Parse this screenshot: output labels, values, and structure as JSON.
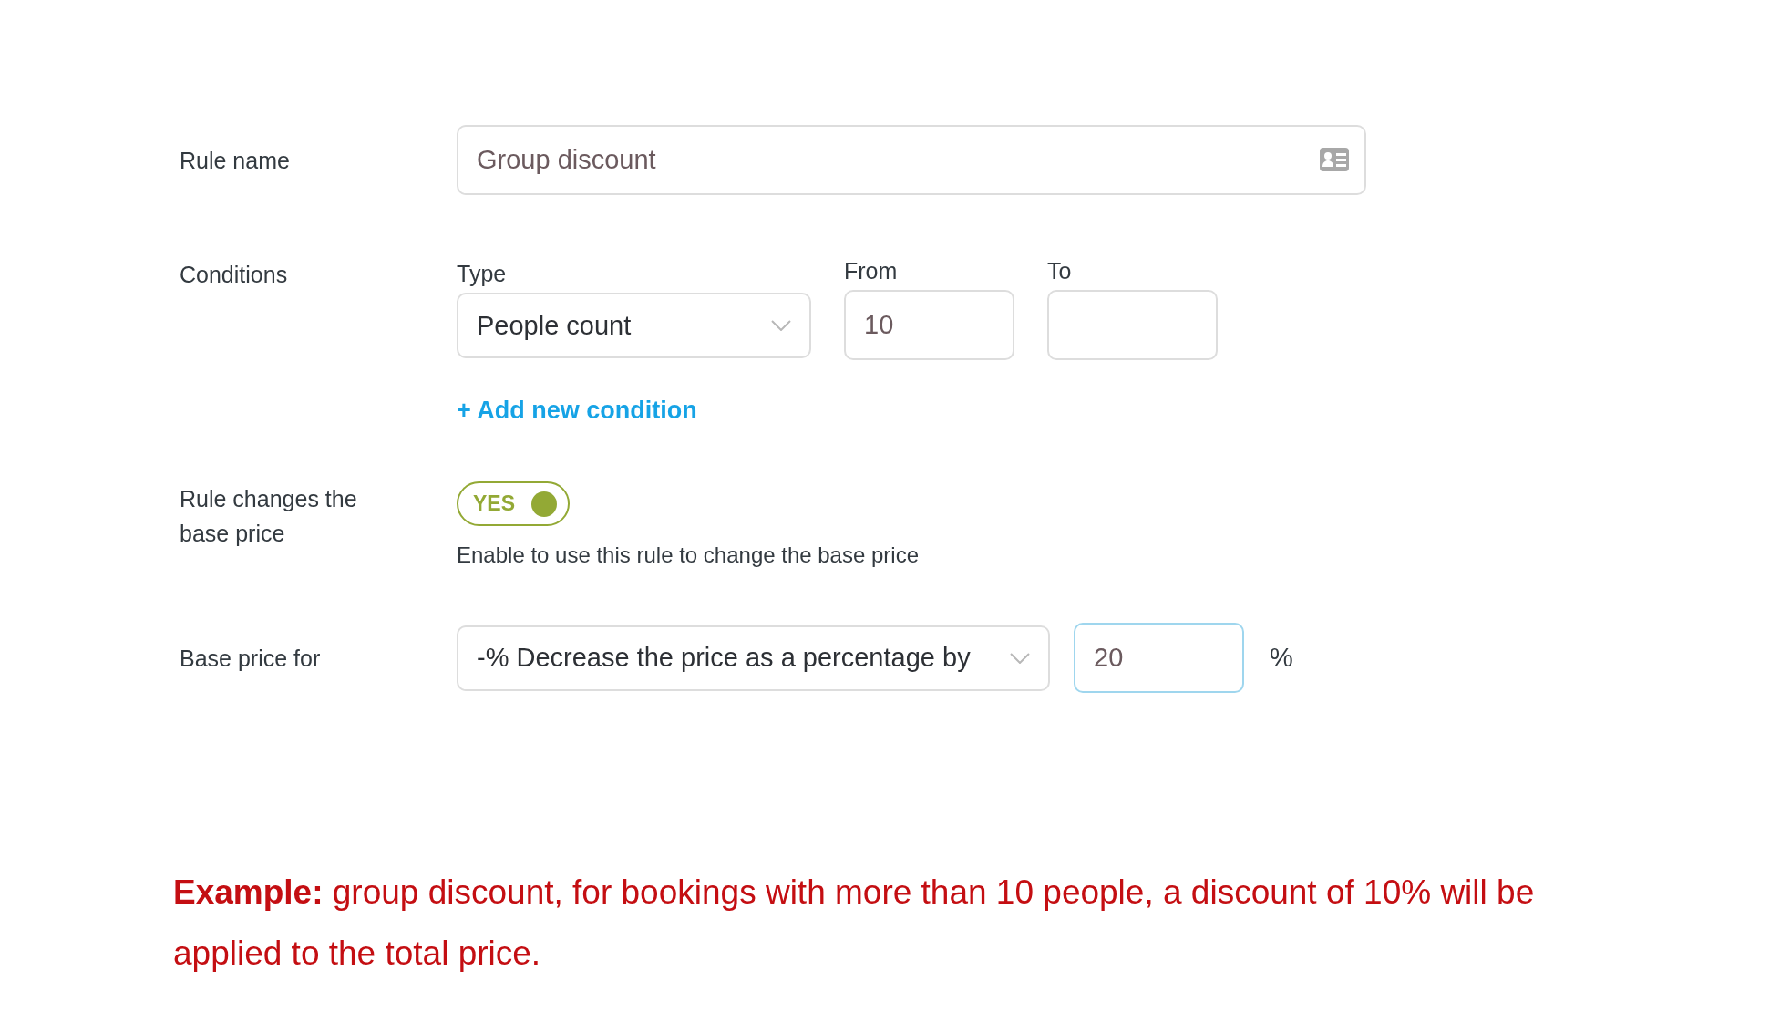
{
  "rule_name": {
    "label": "Rule name",
    "value": "Group discount"
  },
  "conditions": {
    "label": "Conditions",
    "type": {
      "label": "Type",
      "value": "People count"
    },
    "from": {
      "label": "From",
      "value": "10"
    },
    "to": {
      "label": "To"
    },
    "add_link": "+ Add new condition"
  },
  "price_change": {
    "label": "Rule changes the base price",
    "toggle": {
      "on": true,
      "text": "YES"
    },
    "hint": "Enable to use this rule to change the base price"
  },
  "base_price": {
    "label": "Base price for",
    "mode": "-% Decrease the price as a percentage by",
    "amount": {
      "value": "20",
      "focused": true
    },
    "unit": "%"
  },
  "example": "**Example:** group discount, for bookings with more than 10 people, a discount of 10% will be applied to the total price."
}
